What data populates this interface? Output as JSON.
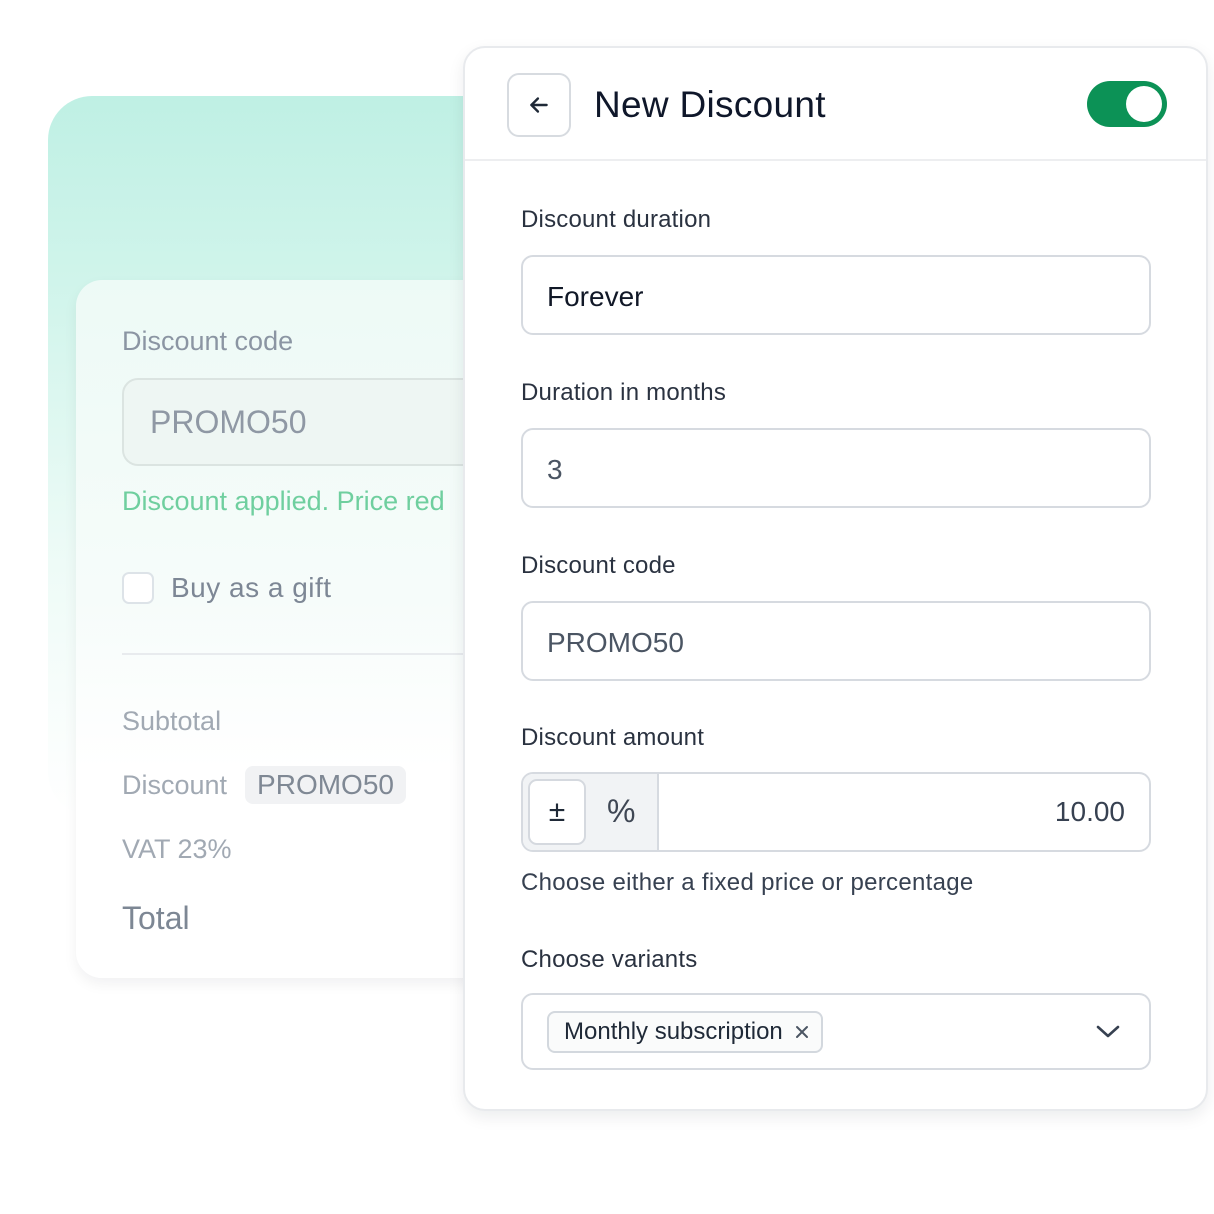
{
  "checkout": {
    "discount_code_label": "Discount code",
    "discount_code_value": "PROMO50",
    "applied_message": "Discount applied. Price red",
    "gift_label": "Buy as a gift",
    "subtotal_label": "Subtotal",
    "discount_label": "Discount",
    "discount_tag": "PROMO50",
    "vat_label": "VAT 23%",
    "total_label": "Total"
  },
  "panel": {
    "title": "New Discount",
    "active": true,
    "fields": {
      "duration_label": "Discount duration",
      "duration_value": "Forever",
      "months_label": "Duration in months",
      "months_value": "3",
      "code_label": "Discount code",
      "code_value": "PROMO50",
      "amount_label": "Discount amount",
      "amount_fixed_symbol": "±",
      "amount_percent_symbol": "%",
      "amount_value": "10.00",
      "amount_help": "Choose either a fixed price or percentage",
      "variants_label": "Choose variants",
      "variant_chip": "Monthly subscription"
    }
  },
  "colors": {
    "toggle_on": "#0c9256",
    "applied_text": "#6fcf9f",
    "background_gradient": "#bff0e4"
  },
  "icons": [
    "arrow-left-icon",
    "close-icon",
    "chevron-down-icon"
  ]
}
